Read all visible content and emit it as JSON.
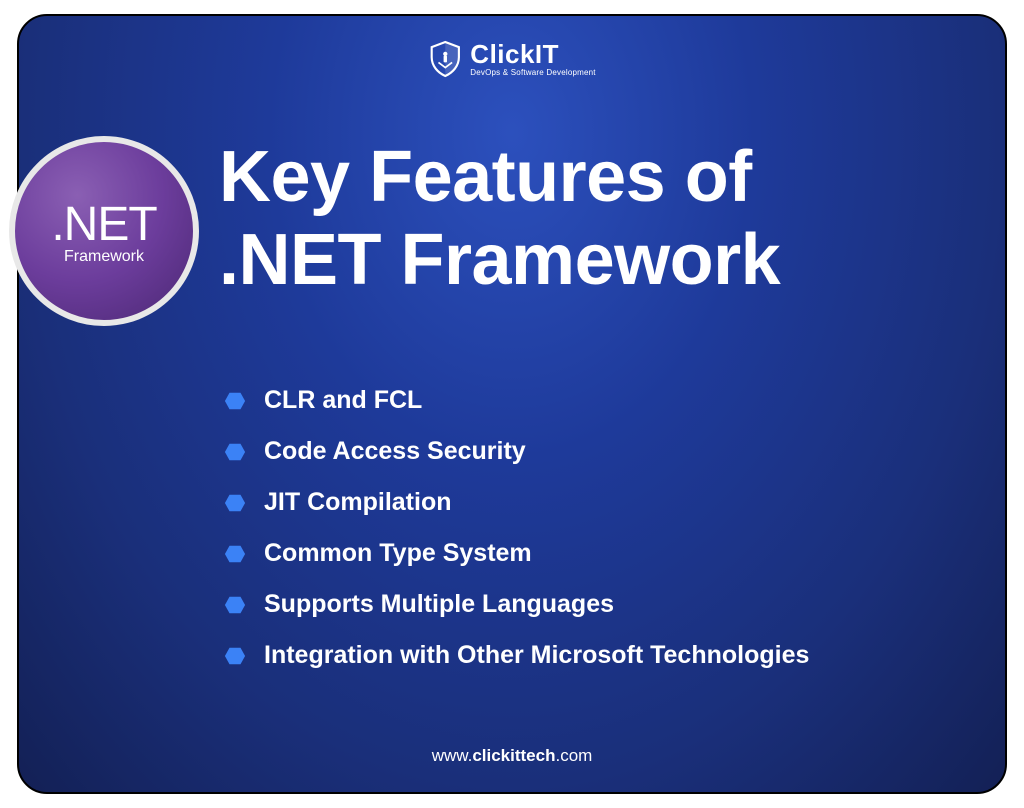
{
  "brand": {
    "name": "ClickIT",
    "tagline": "DevOps & Software Development"
  },
  "badge": {
    "main": ".NET",
    "sub": "Framework"
  },
  "title": {
    "line1": "Key Features of",
    "line2": ".NET Framework"
  },
  "features": [
    "CLR and FCL",
    "Code Access Security",
    "JIT Compilation",
    "Common Type System",
    "Supports Multiple Languages",
    "Integration with Other Microsoft Technologies"
  ],
  "footer": {
    "prefix": "www.",
    "bold": "clickittech",
    "suffix": ".com"
  },
  "colors": {
    "bullet": "#3b82f6"
  }
}
